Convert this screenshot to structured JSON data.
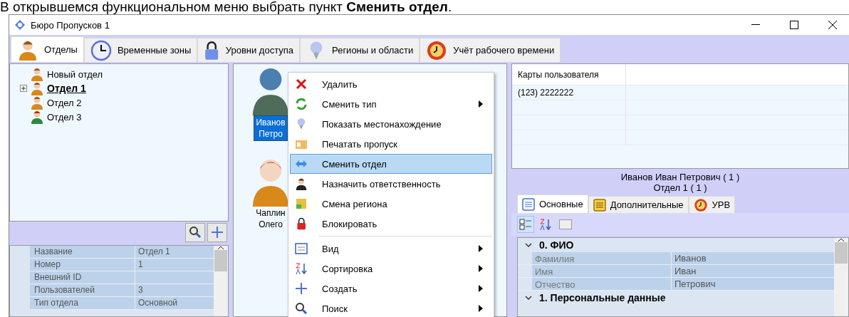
{
  "caption": "В открывшемся функциональном меню выбрать пункт **Сменить отдел**.",
  "window": {
    "title": "Бюро Пропусков 1"
  },
  "tabs": [
    {
      "label": "Отделы",
      "selected": true
    },
    {
      "label": "Временные зоны",
      "selected": false
    },
    {
      "label": "Уровни доступа",
      "selected": false
    },
    {
      "label": "Регионы и области",
      "selected": false
    },
    {
      "label": "Учёт рабочего времени",
      "selected": false
    }
  ],
  "tree": [
    {
      "label": "Новый отдел",
      "selected": false
    },
    {
      "label": "Отдел 1",
      "selected": true,
      "expanded": false
    },
    {
      "label": "Отдел 2",
      "selected": false
    },
    {
      "label": "Отдел 3",
      "selected": false
    }
  ],
  "department_properties": [
    {
      "name": "Название",
      "value": "Отдел 1"
    },
    {
      "name": "Номер",
      "value": "1"
    },
    {
      "name": "Внешний ID"
    },
    {
      "name": "Пользователей",
      "value": "3"
    },
    {
      "name": "Тип отдела",
      "value": "Основной"
    }
  ],
  "users": [
    {
      "lines": [
        "Иванов",
        "Петро"
      ],
      "selected": true
    },
    {
      "lines": [
        "Чаплин",
        "Олего"
      ],
      "selected": false
    }
  ],
  "context_menu": [
    {
      "label": "Удалить",
      "submenu": false,
      "selected": false
    },
    {
      "label": "Сменить тип",
      "submenu": true,
      "selected": false
    },
    {
      "label": "Показать местонахождение",
      "submenu": false,
      "selected": false
    },
    {
      "label": "Печатать пропуск",
      "submenu": false,
      "selected": false
    },
    {
      "label": "Сменить отдел",
      "submenu": false,
      "selected": true
    },
    {
      "label": "Назначить ответственность",
      "submenu": false,
      "selected": false
    },
    {
      "label": "Смена региона",
      "submenu": false,
      "selected": false
    },
    {
      "label": "Блокировать",
      "submenu": false,
      "selected": false,
      "separator_after": true
    },
    {
      "label": "Вид",
      "submenu": true,
      "selected": false
    },
    {
      "label": "Сортировка",
      "submenu": true,
      "selected": false
    },
    {
      "label": "Создать",
      "submenu": true,
      "selected": false
    },
    {
      "label": "Поиск",
      "submenu": true,
      "selected": false
    }
  ],
  "cards_table": {
    "columns": [
      "Карты пользователя"
    ],
    "rows": [
      [
        "(123) 2222222"
      ]
    ]
  },
  "user_header": {
    "name": "Иванов Иван Петрович ( 1 )",
    "department": "Отдел 1 ( 1 )"
  },
  "user_tabs": [
    {
      "label": "Основные",
      "selected": true
    },
    {
      "label": "Дополнительные",
      "selected": false
    },
    {
      "label": "УРВ",
      "selected": false
    }
  ],
  "user_properties": [
    {
      "kind": "category",
      "name": "0. ФИО",
      "expanded": true
    },
    {
      "kind": "property",
      "name": "Фамилия",
      "value": "Иванов"
    },
    {
      "kind": "property",
      "name": "Имя",
      "value": "Иван"
    },
    {
      "kind": "property",
      "name": "Отчество",
      "value": "Петрович"
    },
    {
      "kind": "category",
      "name": "1. Персональные данные",
      "expanded": true
    }
  ]
}
